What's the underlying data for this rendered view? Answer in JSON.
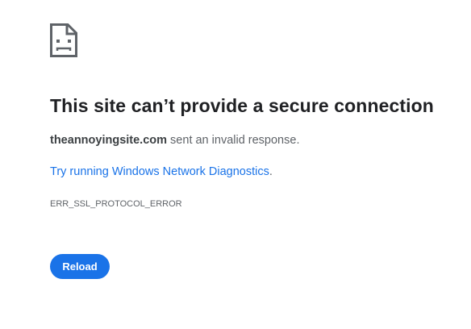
{
  "icon": "sad-page-icon",
  "title": "This site can’t provide a secure connection",
  "message": {
    "domain": "theannoyingsite.com",
    "text": " sent an invalid response."
  },
  "diagnostics_link": {
    "label": "Try running Windows Network Diagnostics",
    "suffix": "."
  },
  "error_code": "ERR_SSL_PROTOCOL_ERROR",
  "reload_button": {
    "label": "Reload"
  },
  "colors": {
    "accent": "#1a73e8",
    "title": "#202124",
    "body_text": "#5f6368",
    "background": "#ffffff"
  }
}
